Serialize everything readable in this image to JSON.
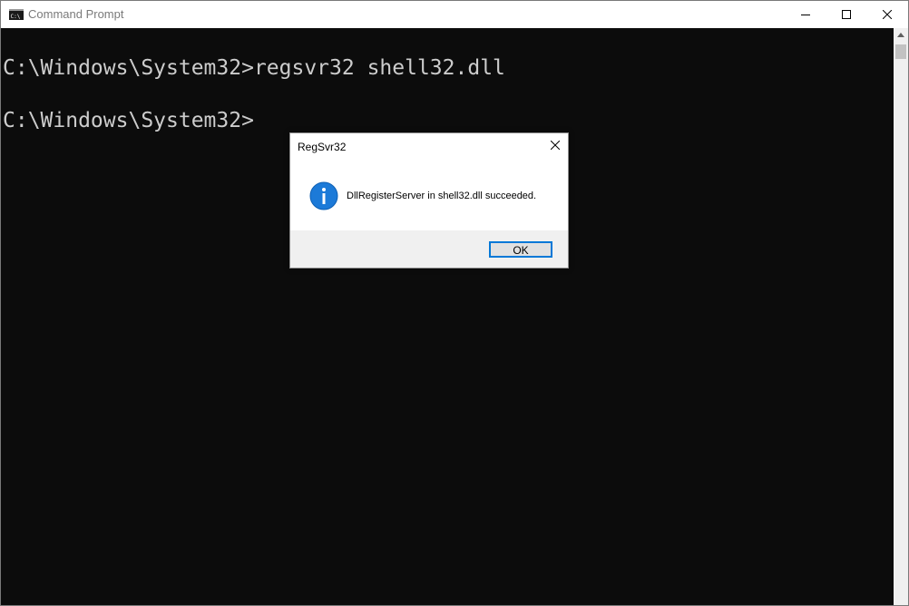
{
  "window": {
    "title": "Command Prompt",
    "icon": "cmd-app-icon",
    "controls": {
      "minimize_icon": "minimize-icon",
      "maximize_icon": "maximize-icon",
      "close_icon": "close-icon"
    }
  },
  "console": {
    "lines": [
      "C:\\Windows\\System32>regsvr32 shell32.dll",
      "C:\\Windows\\System32>"
    ],
    "text_color": "#cccccc",
    "background": "#0c0c0c"
  },
  "dialog": {
    "title": "RegSvr32",
    "message": "DllRegisterServer in shell32.dll succeeded.",
    "icon": "info-icon",
    "ok_label": "OK",
    "accent": "#0078d7"
  }
}
